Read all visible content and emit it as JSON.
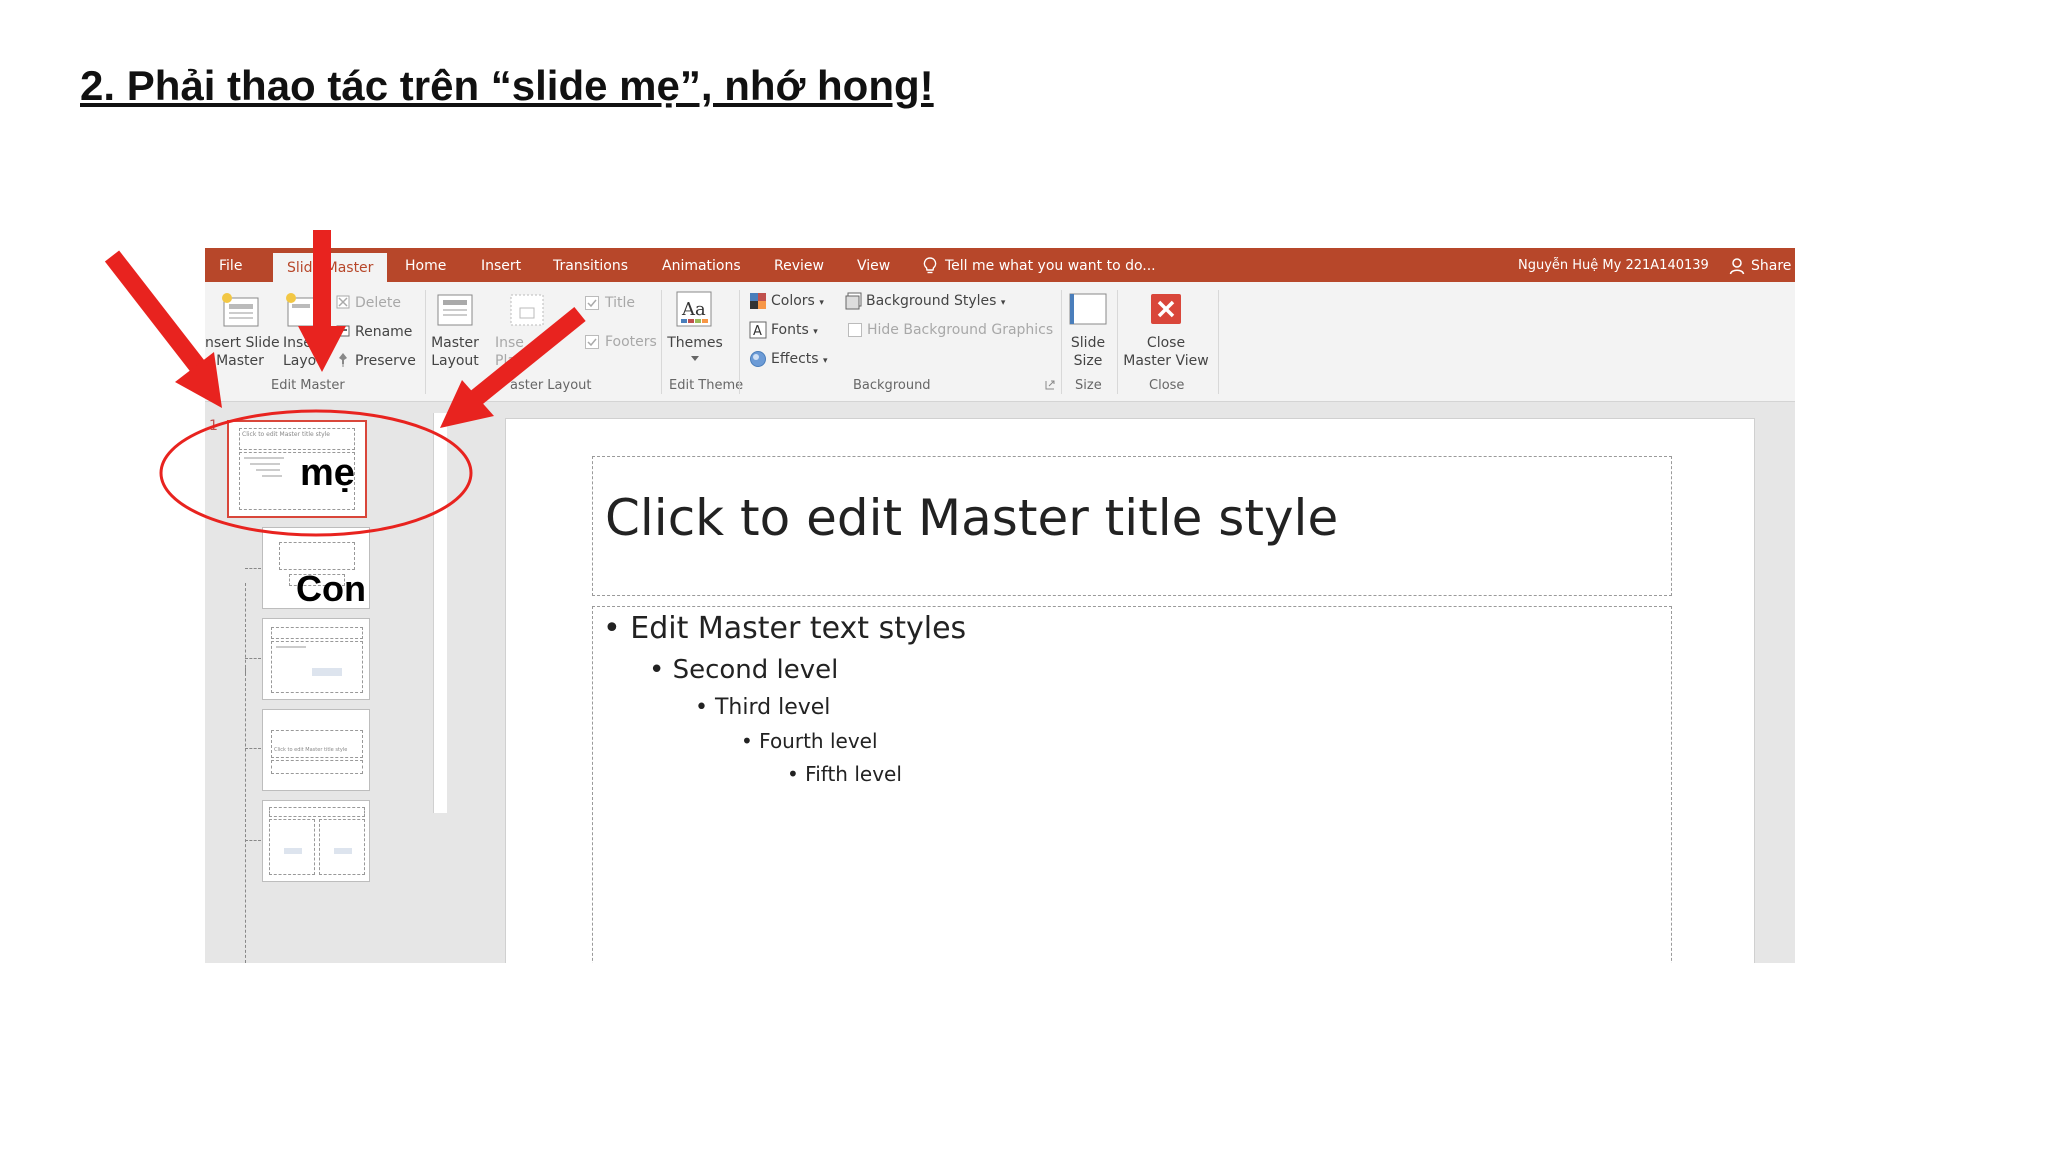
{
  "heading": "2. Phải thao tác trên “slide mẹ”, nhớ hong!",
  "app": {
    "tabs": [
      {
        "label": "File"
      },
      {
        "label": "Slide Master",
        "active": true
      },
      {
        "label": "Home"
      },
      {
        "label": "Insert"
      },
      {
        "label": "Transitions"
      },
      {
        "label": "Animations"
      },
      {
        "label": "Review"
      },
      {
        "label": "View"
      }
    ],
    "tell_me": "Tell me what you want to do...",
    "user_name": "Nguyễn Huệ My 221A140139",
    "share_label": "Share",
    "accent_color": "#b7472a"
  },
  "ribbon": {
    "edit_master": {
      "label": "Edit Master",
      "insert_slide_master": [
        "nsert Slide",
        "Master"
      ],
      "insert_layout": [
        "Inse",
        "Layo"
      ],
      "delete": "Delete",
      "rename": "Rename",
      "preserve": "Preserve"
    },
    "master_layout": {
      "label": "aster Layout",
      "master_layout_btn": [
        "Master",
        "Layout"
      ],
      "insert_placeholder": [
        "Inse",
        "Pla"
      ],
      "title": "Title",
      "footers": "Footers"
    },
    "edit_theme": {
      "label": "Edit Theme",
      "themes": "Themes"
    },
    "background": {
      "label": "Background",
      "colors": "Colors",
      "fonts": "Fonts",
      "effects": "Effects",
      "background_styles": "Background Styles",
      "hide_bg_graphics": "Hide Background Graphics"
    },
    "size": {
      "label": "Size",
      "slide_size": [
        "Slide",
        "Size"
      ]
    },
    "close": {
      "label": "Close",
      "close_master_view": [
        "Close",
        "Master View"
      ]
    }
  },
  "thumbnails": {
    "slide_number": "1",
    "mini_title": "Click to edit Master title style",
    "mini_title_4": "Click to edit Master title style"
  },
  "slide": {
    "title": "Click to edit Master title style",
    "levels": [
      "Edit Master text styles",
      "Second level",
      "Third level",
      "Fourth level",
      "Fifth level"
    ]
  },
  "callouts": {
    "mother": "mẹ",
    "child": "Con"
  },
  "annotation_color": "#e8231f"
}
